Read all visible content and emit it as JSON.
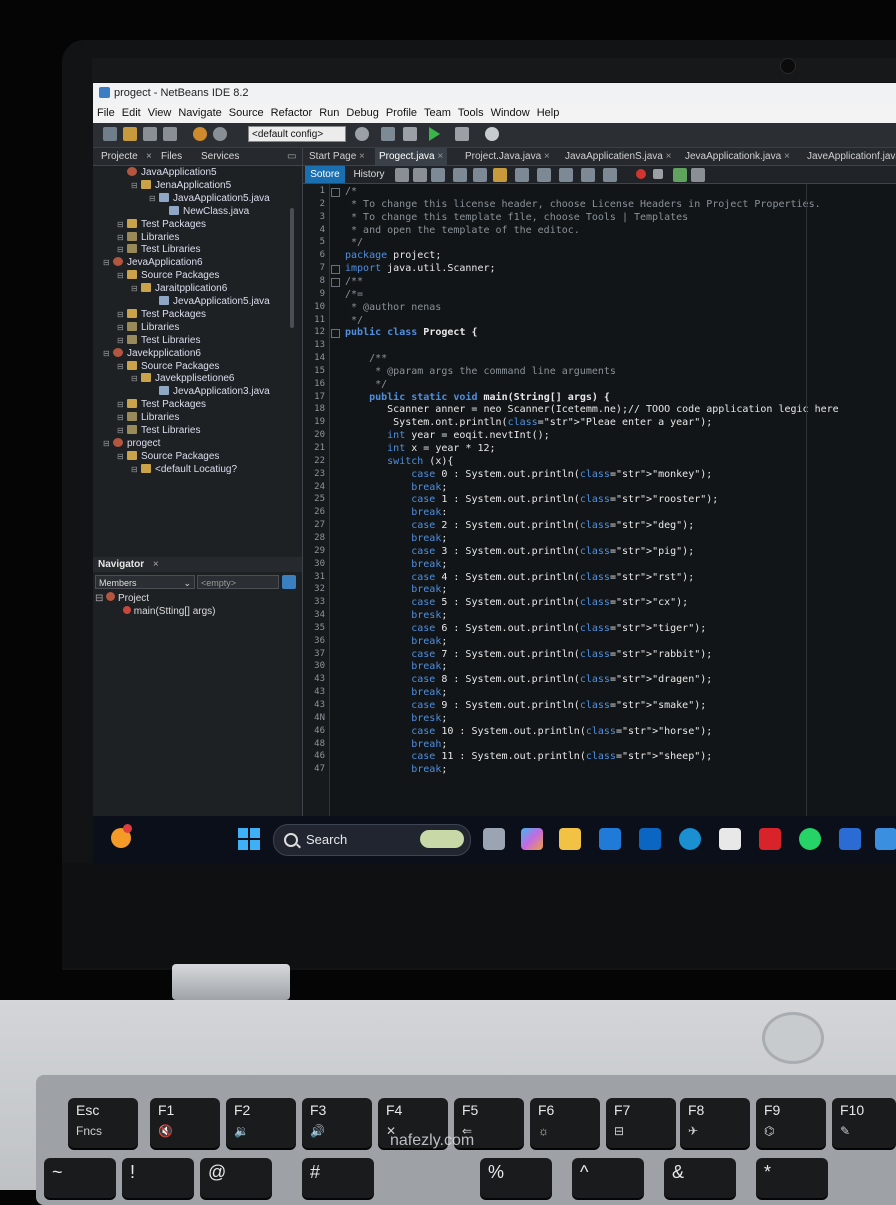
{
  "window": {
    "title": "progect - NetBeans IDE 8.2"
  },
  "menu": [
    "File",
    "Edit",
    "View",
    "Navigate",
    "Source",
    "Refactor",
    "Run",
    "Debug",
    "Profile",
    "Team",
    "Tools",
    "Window",
    "Help"
  ],
  "toolbar": {
    "config": "<default config>"
  },
  "left_panel": {
    "tabs": [
      "Projecte",
      "Files",
      "Services"
    ],
    "tree": [
      {
        "label": "JavaApplication5",
        "type": "proj"
      },
      {
        "label": "JenaApplication5",
        "type": "pkg"
      },
      {
        "label": "JavaApplication5.java",
        "type": "file"
      },
      {
        "label": "NewClass.java",
        "type": "file"
      },
      {
        "label": "Test Packages",
        "type": "pkg"
      },
      {
        "label": "Libraries",
        "type": "lib"
      },
      {
        "label": "Test Libraries",
        "type": "lib"
      },
      {
        "label": "JevaApplication6",
        "type": "proj"
      },
      {
        "label": "Source Packages",
        "type": "pkg"
      },
      {
        "label": "Jaraitpplication6",
        "type": "pkg"
      },
      {
        "label": "JevaApplication5.java",
        "type": "file"
      },
      {
        "label": "Test Packages",
        "type": "pkg"
      },
      {
        "label": "Libraries",
        "type": "lib"
      },
      {
        "label": "Test Libraries",
        "type": "lib"
      },
      {
        "label": "Javekpplication6",
        "type": "proj"
      },
      {
        "label": "Source Packages",
        "type": "pkg"
      },
      {
        "label": "Javekpplisetione6",
        "type": "pkg"
      },
      {
        "label": "JevaApplication3.java",
        "type": "file"
      },
      {
        "label": "Test Packages",
        "type": "pkg"
      },
      {
        "label": "Libraries",
        "type": "lib"
      },
      {
        "label": "Test Libraries",
        "type": "lib"
      },
      {
        "label": "progect",
        "type": "proj"
      },
      {
        "label": "Source Packages",
        "type": "pkg"
      },
      {
        "label": "<default Locatiug?",
        "type": "pkg"
      }
    ],
    "navigator": {
      "title": "Navigator",
      "members": "Members",
      "filter": "<empty>",
      "root": "Project",
      "method": "main(Stting[] args)"
    }
  },
  "editor": {
    "tabs": [
      "Start Page",
      "Progect.java",
      "Project.Java.java",
      "JavaApplicatienS.java",
      "JevaApplicationk.java",
      "JaveApplicationf.java"
    ],
    "subtabs": {
      "source": "Sotore",
      "history": "History"
    },
    "lines": [
      {
        "n": "1",
        "t": "/*",
        "c": "cm"
      },
      {
        "n": "2",
        "t": " * To change this license header, choose License Headers in Project Properties.",
        "c": "cm"
      },
      {
        "n": "3",
        "t": " * To change this template f1le, choose Tools | Templates",
        "c": "cm"
      },
      {
        "n": "4",
        "t": " * and open the template of the editoc.",
        "c": "cm"
      },
      {
        "n": "5",
        "t": " */",
        "c": "cm"
      },
      {
        "n": "6",
        "t": "package project;",
        "c": "pkg"
      },
      {
        "n": "7",
        "t": "import java.util.Scanner;",
        "c": "imp"
      },
      {
        "n": "8",
        "t": "/**",
        "c": "cm"
      },
      {
        "n": "9",
        "t": "/*=",
        "c": "cm"
      },
      {
        "n": "10",
        "t": " * @author nenas",
        "c": "cm"
      },
      {
        "n": "11",
        "t": " */",
        "c": "cm"
      },
      {
        "n": "12",
        "t": "public class Progect {",
        "c": "cls"
      },
      {
        "n": "13",
        "t": "",
        "c": ""
      },
      {
        "n": "14",
        "t": "    /**",
        "c": "cm"
      },
      {
        "n": "15",
        "t": "     * @param args the command line arguments",
        "c": "cm"
      },
      {
        "n": "16",
        "t": "     */",
        "c": "cm"
      },
      {
        "n": "17",
        "t": "    public static void main(String[] args) {",
        "c": "main"
      },
      {
        "n": "18",
        "t": "       Scanner anner = neo Scanner(Icetemm.ne);// TOOO code application legic here",
        "c": "plain"
      },
      {
        "n": "19",
        "t": "        System.ont.println(\"Pleae enter a year\");",
        "c": "str"
      },
      {
        "n": "20",
        "t": "       int year = eoqit.nevtInt();",
        "c": "int"
      },
      {
        "n": "21",
        "t": "       int x = year * 12;",
        "c": "int"
      },
      {
        "n": "22",
        "t": "       switch (x){",
        "c": "sw"
      },
      {
        "n": "23",
        "t": "           case 0 : System.out.println(\"monkey\");",
        "c": "case"
      },
      {
        "n": "24",
        "t": "           break;",
        "c": "brk"
      },
      {
        "n": "25",
        "t": "           case 1 : System.out.println(\"rooster\");",
        "c": "case"
      },
      {
        "n": "26",
        "t": "           break:",
        "c": "brk"
      },
      {
        "n": "27",
        "t": "           case 2 : System.out.println(\"deg\");",
        "c": "case"
      },
      {
        "n": "28",
        "t": "           break;",
        "c": "brk"
      },
      {
        "n": "29",
        "t": "           case 3 : System.out.println(\"pig\");",
        "c": "case"
      },
      {
        "n": "30",
        "t": "           break;",
        "c": "brk"
      },
      {
        "n": "31",
        "t": "           case 4 : System.out.println(\"rst\");",
        "c": "case"
      },
      {
        "n": "32",
        "t": "           break;",
        "c": "brk"
      },
      {
        "n": "33",
        "t": "           case 5 : System.out.println(\"cx\");",
        "c": "case"
      },
      {
        "n": "34",
        "t": "           bresk;",
        "c": "brk"
      },
      {
        "n": "35",
        "t": "           case 6 : System.out.println(\"tiger\");",
        "c": "case"
      },
      {
        "n": "36",
        "t": "           break;",
        "c": "brk"
      },
      {
        "n": "37",
        "t": "           case 7 : System.out.println(\"rabbit\");",
        "c": "case"
      },
      {
        "n": "30",
        "t": "           break;",
        "c": "brk"
      },
      {
        "n": "43",
        "t": "           case 8 : System.out.println(\"dragen\");",
        "c": "case"
      },
      {
        "n": "43",
        "t": "           break;",
        "c": "brk"
      },
      {
        "n": "43",
        "t": "           case 9 : System.out.println(\"smake\");",
        "c": "case"
      },
      {
        "n": "4N",
        "t": "           bresk;",
        "c": "brk"
      },
      {
        "n": "46",
        "t": "           case 10 : System.out.println(\"horse\");",
        "c": "case"
      },
      {
        "n": "48",
        "t": "           breah;",
        "c": "brk"
      },
      {
        "n": "46",
        "t": "           case 11 : System.out.println(\"sheep\");",
        "c": "case"
      },
      {
        "n": "47",
        "t": "           break;",
        "c": "brk"
      }
    ]
  },
  "taskbar": {
    "search": "Search",
    "apps": [
      "task-view",
      "copilot",
      "file-explorer",
      "mail",
      "linkedin",
      "edge",
      "store",
      "red-app",
      "whatsapp",
      "blue-app"
    ]
  },
  "keyboard": {
    "keys": [
      {
        "top": "Esc",
        "bottom": "Fncs"
      },
      {
        "top": "F1",
        "bottom": "🔇"
      },
      {
        "top": "F2",
        "bottom": "🔉"
      },
      {
        "top": "F3",
        "bottom": "🔊"
      },
      {
        "top": "F4",
        "bottom": "✕"
      },
      {
        "top": "F5",
        "bottom": "⇐"
      },
      {
        "top": "F6",
        "bottom": "☼"
      },
      {
        "top": "F7",
        "bottom": "⊟"
      },
      {
        "top": "F8",
        "bottom": "✈"
      },
      {
        "top": "F9",
        "bottom": "⌬"
      },
      {
        "top": "F10",
        "bottom": "✎"
      }
    ],
    "row2": [
      "~",
      "!",
      "@",
      "#",
      "%",
      "^",
      "&",
      "*"
    ]
  },
  "watermark": "nafezly.com"
}
